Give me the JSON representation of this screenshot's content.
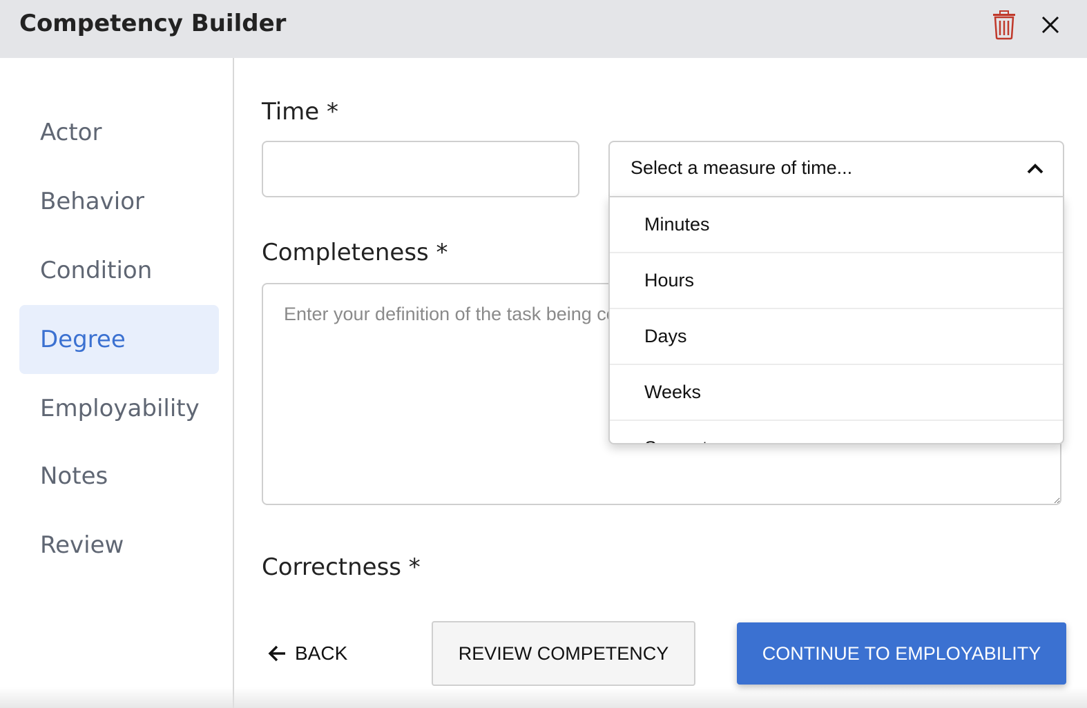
{
  "header": {
    "title": "Competency Builder",
    "delete_icon": "trash-icon",
    "close_icon": "close-icon",
    "delete_color": "#c0392b"
  },
  "sidebar": {
    "items": [
      {
        "label": "Actor",
        "active": false
      },
      {
        "label": "Behavior",
        "active": false
      },
      {
        "label": "Condition",
        "active": false
      },
      {
        "label": "Degree",
        "active": true
      },
      {
        "label": "Employability",
        "active": false
      },
      {
        "label": "Notes",
        "active": false
      },
      {
        "label": "Review",
        "active": false
      }
    ]
  },
  "form": {
    "time": {
      "label": "Time *",
      "value": "",
      "select_placeholder": "Select a measure of time...",
      "options": [
        "Minutes",
        "Hours",
        "Days",
        "Weeks",
        "Semesters"
      ]
    },
    "completeness": {
      "label": "Completeness *",
      "placeholder": "Enter your definition of the task being completed..."
    },
    "correctness": {
      "label": "Correctness *"
    }
  },
  "actions": {
    "back_label": "BACK",
    "review_label": "REVIEW COMPETENCY",
    "continue_label": "CONTINUE TO EMPLOYABILITY"
  },
  "colors": {
    "accent": "#3b71d1",
    "active_bg": "#e8effc",
    "header_bg": "#e4e5e8"
  }
}
